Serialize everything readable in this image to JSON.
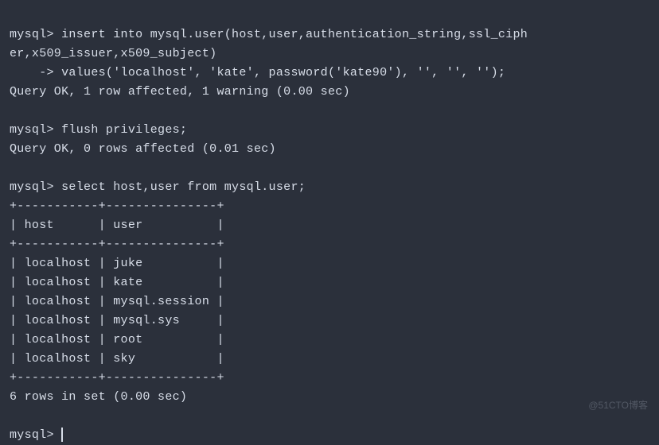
{
  "terminal": {
    "prompt": "mysql>",
    "continuation": "    ->",
    "lines": {
      "insert1": "mysql> insert into mysql.user(host,user,authentication_string,ssl_ciph",
      "insert2": "er,x509_issuer,x509_subject)",
      "insert3": "    -> values('localhost', 'kate', password('kate90'), '', '', '');",
      "insert_result": "Query OK, 1 row affected, 1 warning (0.00 sec)",
      "blank1": "",
      "flush": "mysql> flush privileges;",
      "flush_result": "Query OK, 0 rows affected (0.01 sec)",
      "blank2": "",
      "select": "mysql> select host,user from mysql.user;",
      "table_top": "+-----------+---------------+",
      "table_header": "| host      | user          |",
      "table_sep": "+-----------+---------------+",
      "table_row1": "| localhost | juke          |",
      "table_row2": "| localhost | kate          |",
      "table_row3": "| localhost | mysql.session |",
      "table_row4": "| localhost | mysql.sys     |",
      "table_row5": "| localhost | root          |",
      "table_row6": "| localhost | sky           |",
      "table_bottom": "+-----------+---------------+",
      "select_result": "6 rows in set (0.00 sec)",
      "blank3": "",
      "prompt_last": "mysql> "
    }
  },
  "watermark": "@51CTO博客"
}
